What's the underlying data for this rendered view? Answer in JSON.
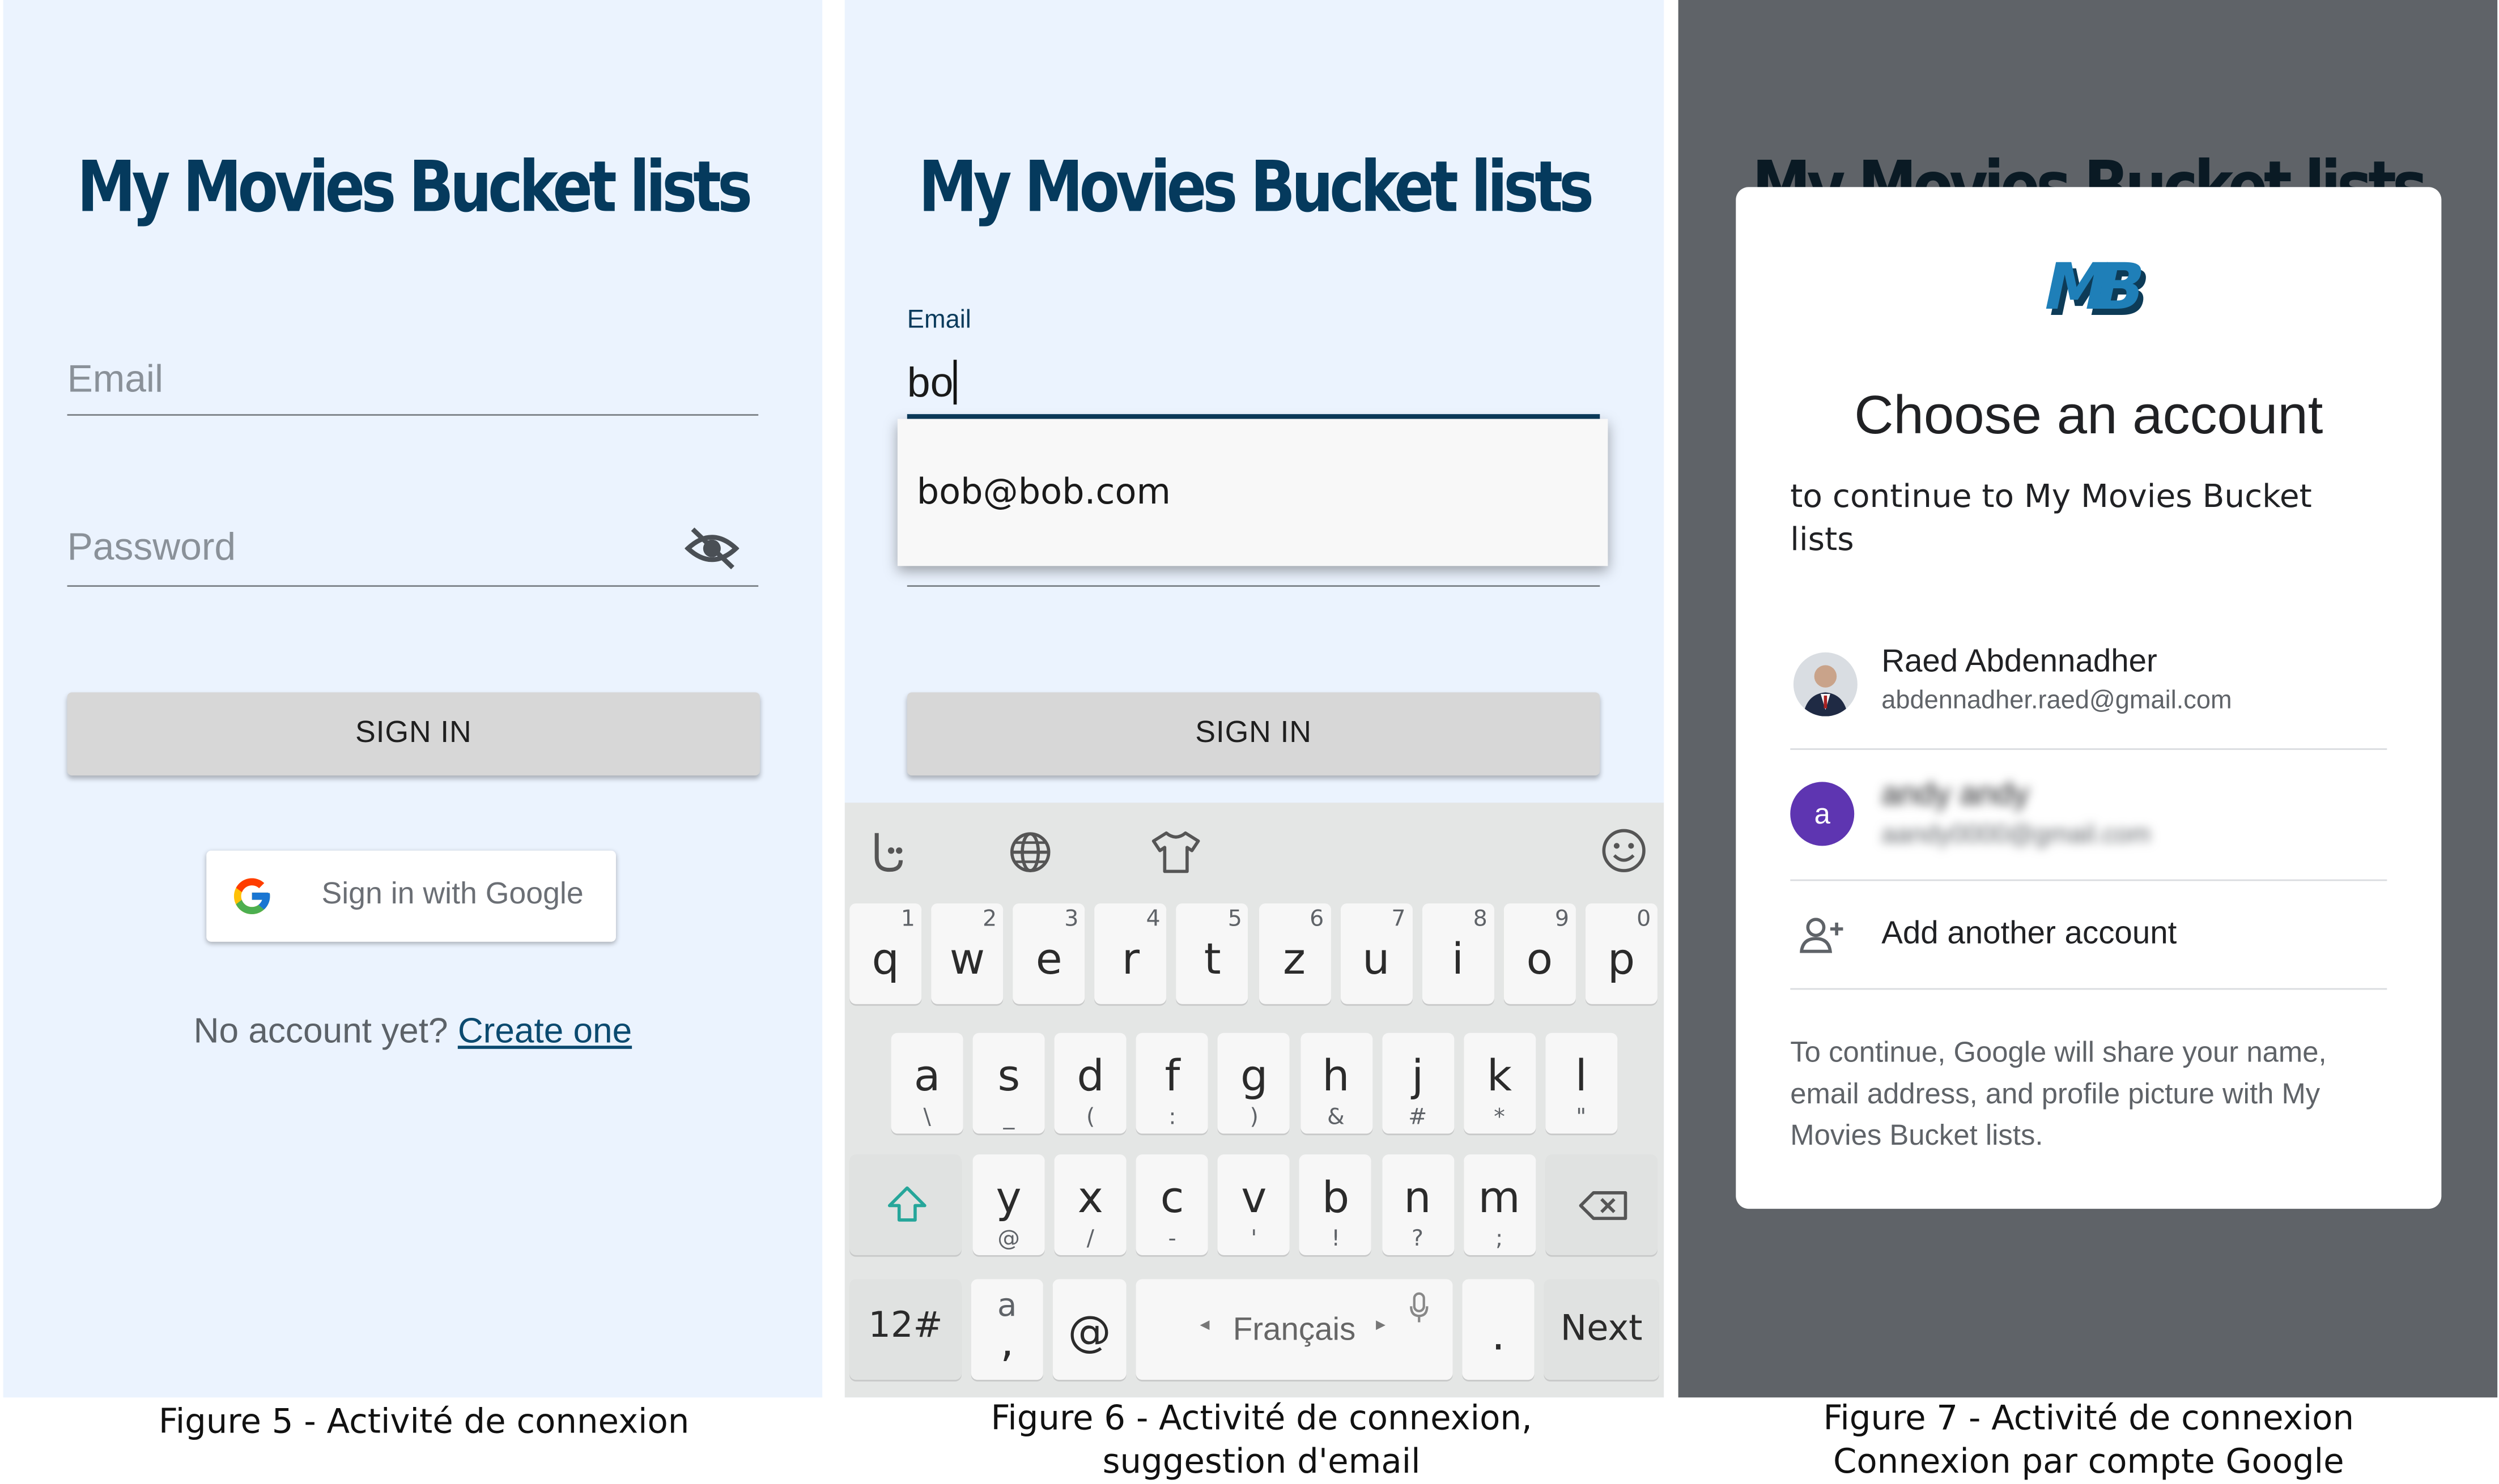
{
  "screens": {
    "login": {
      "app_title": "My Movies Bucket lists",
      "email_placeholder": "Email",
      "password_placeholder": "Password",
      "signin_label": "SIGN IN",
      "google_label": "Sign in with Google",
      "no_account_text": "No account yet?",
      "create_link": "Create one",
      "caption": "Figure 5 - Activité de connexion"
    },
    "suggestion": {
      "app_title": "My Movies Bucket lists",
      "email_label": "Email",
      "email_value": "bo",
      "suggestion_item": "bob@bob.com",
      "signin_label": "SIGN IN",
      "caption_line1": "Figure 6 - Activité de connexion,",
      "caption_line2": "suggestion d'email",
      "keyboard": {
        "row1": [
          {
            "key": "q",
            "hint": "1"
          },
          {
            "key": "w",
            "hint": "2"
          },
          {
            "key": "e",
            "hint": "3"
          },
          {
            "key": "r",
            "hint": "4"
          },
          {
            "key": "t",
            "hint": "5"
          },
          {
            "key": "z",
            "hint": "6"
          },
          {
            "key": "u",
            "hint": "7"
          },
          {
            "key": "i",
            "hint": "8"
          },
          {
            "key": "o",
            "hint": "9"
          },
          {
            "key": "p",
            "hint": "0"
          }
        ],
        "row2": [
          {
            "key": "a",
            "hint": "\\"
          },
          {
            "key": "s",
            "hint": "_"
          },
          {
            "key": "d",
            "hint": "("
          },
          {
            "key": "f",
            "hint": ":"
          },
          {
            "key": "g",
            "hint": ")"
          },
          {
            "key": "h",
            "hint": "&"
          },
          {
            "key": "j",
            "hint": "#"
          },
          {
            "key": "k",
            "hint": "*"
          },
          {
            "key": "l",
            "hint": "\""
          }
        ],
        "row3": [
          {
            "key": "y",
            "hint": "@"
          },
          {
            "key": "x",
            "hint": "/"
          },
          {
            "key": "c",
            "hint": "-"
          },
          {
            "key": "v",
            "hint": "'"
          },
          {
            "key": "b",
            "hint": "!"
          },
          {
            "key": "n",
            "hint": "?"
          },
          {
            "key": "m",
            "hint": ";"
          }
        ],
        "num_key": "12#",
        "comma_key": ",",
        "comma_hint": "a",
        "at_key": "@",
        "space_label": "Français",
        "period_key": ".",
        "next_key": "Next"
      }
    },
    "google": {
      "background_title": "My Movies Bucket lists",
      "logo_text": "MB",
      "dialog_title": "Choose an account",
      "subtitle": "to continue to My Movies Bucket lists",
      "account1_name": "Raed Abdennadher",
      "account1_email": "abdennadher.raed@gmail.com",
      "account2_initial": "a",
      "account2_name": "andy andy",
      "account2_email": "aandy0000@gmail.com",
      "add_account": "Add another account",
      "disclaimer": "To continue, Google will share your name, email address, and profile picture with My Movies Bucket lists.",
      "caption_line1": "Figure 7 - Activité de connexion",
      "caption_line2": "Connexion par compte Google"
    }
  },
  "colors": {
    "screen_bg": "#ebf3fe",
    "title_navy": "#053a5d",
    "dim_overlay": "#5f6368",
    "avatar_purple": "#5e35b1",
    "shift_teal": "#26a69a"
  }
}
